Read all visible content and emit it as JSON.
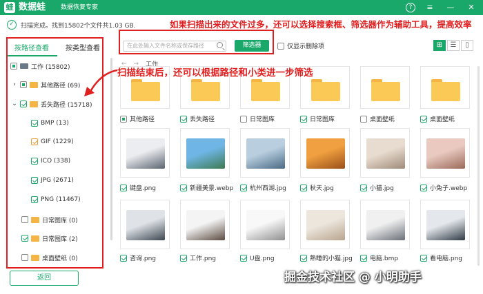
{
  "titlebar": {
    "logo_glyph": "蛙",
    "app_name": "数据蛙",
    "subtitle": "数据恢复专家",
    "help_glyph": "?",
    "menu_glyph": "≡",
    "minimize_glyph": "—",
    "close_glyph": "✕"
  },
  "status": {
    "check_glyph": "✓",
    "text": "扫描完成。找到15802个文件共1.03 GB."
  },
  "annotations": {
    "top_note": "如果扫描出来的文件过多，还可以选择搜索框、筛选器作为辅助工具，提高效率",
    "side_note": "扫描结束后，还可以根据路径和小类进一步筛选",
    "color": "#e02020"
  },
  "sidebar": {
    "tabs": [
      "按路径查看",
      "按类型查看"
    ],
    "tree": [
      {
        "label": "工作 (15802)",
        "state": "partial",
        "chevron": "",
        "icon": "drive"
      },
      {
        "label": "其他路径 (69)",
        "state": "partial",
        "chevron": "›",
        "icon": "folder"
      },
      {
        "label": "丢失路径 (15718)",
        "state": "checked",
        "chevron": "⌄",
        "icon": "folder"
      },
      {
        "label": "BMP (13)",
        "state": "checked",
        "chevron": "",
        "icon": ""
      },
      {
        "label": "GIF (1229)",
        "state": "checked-orange",
        "chevron": "",
        "icon": ""
      },
      {
        "label": "ICO (338)",
        "state": "checked",
        "chevron": "",
        "icon": ""
      },
      {
        "label": "JPG (2671)",
        "state": "checked",
        "chevron": "",
        "icon": ""
      },
      {
        "label": "PNG (11467)",
        "state": "checked",
        "chevron": "",
        "icon": ""
      },
      {
        "label": "日常图库 (0)",
        "state": "unchecked",
        "chevron": "",
        "icon": "folder"
      },
      {
        "label": "日常图库 (2)",
        "state": "checked",
        "chevron": "",
        "icon": "folder"
      },
      {
        "label": "桌面壁纸 (0)",
        "state": "unchecked",
        "chevron": "",
        "icon": "folder"
      }
    ],
    "back_label": "返回"
  },
  "toolbar": {
    "search_placeholder": "在此处输入文件名称或保存路径",
    "filter_label": "筛选器",
    "deleted_only_label": "仅显示删除项",
    "view_glyphs": [
      "⊞",
      "☰",
      "▯"
    ]
  },
  "breadcrumb": [
    "←",
    "→",
    "工作"
  ],
  "grid": [
    {
      "name": "其他路径",
      "kind": "folder",
      "state": "partial",
      "icon": "folder-icon"
    },
    {
      "name": "丢失路径",
      "kind": "folder",
      "state": "checked",
      "icon": "folder-icon"
    },
    {
      "name": "日常图库",
      "kind": "folder",
      "state": "unchecked",
      "icon": "folder-icon"
    },
    {
      "name": "日常图库",
      "kind": "folder",
      "state": "checked",
      "icon": "folder-icon"
    },
    {
      "name": "桌面壁纸",
      "kind": "folder",
      "state": "unchecked",
      "icon": "folder-icon"
    },
    {
      "name": "桌面壁纸",
      "kind": "folder",
      "state": "checked",
      "icon": "folder-icon"
    },
    {
      "name": "键盘.png",
      "kind": "image",
      "state": "checked",
      "icon": "keyboard-thumbnail",
      "colors": [
        "#ecedf0",
        "#5a6470"
      ]
    },
    {
      "name": "新疆美景.webp",
      "kind": "image",
      "state": "checked",
      "icon": "landscape-thumbnail",
      "colors": [
        "#6fb6e6",
        "#3d7a52"
      ]
    },
    {
      "name": "杭州西湖.jpg",
      "kind": "image",
      "state": "checked",
      "icon": "lake-thumbnail",
      "colors": [
        "#b9cfe0",
        "#4a6a84"
      ]
    },
    {
      "name": "秋天.jpg",
      "kind": "image",
      "state": "checked",
      "icon": "autumn-thumbnail",
      "colors": [
        "#f0a040",
        "#9a5018"
      ]
    },
    {
      "name": "小猫.jpg",
      "kind": "image",
      "state": "checked",
      "icon": "kitten-thumbnail",
      "colors": [
        "#e8dcd0",
        "#a08a78"
      ]
    },
    {
      "name": "小兔子.webp",
      "kind": "image",
      "state": "checked",
      "icon": "rabbit-thumbnail",
      "colors": [
        "#e9c9c0",
        "#9a6a5a"
      ]
    },
    {
      "name": "咨询.png",
      "kind": "image",
      "state": "checked",
      "icon": "consult-thumbnail",
      "colors": [
        "#dfe3e8",
        "#3c4650"
      ]
    },
    {
      "name": "工作.png",
      "kind": "image",
      "state": "checked",
      "icon": "work-thumbnail",
      "colors": [
        "#f4f4f4",
        "#5a4a40"
      ]
    },
    {
      "name": "U盘.png",
      "kind": "image",
      "state": "checked",
      "icon": "usb-thumbnail",
      "colors": [
        "#f8f8f8",
        "#909090"
      ]
    },
    {
      "name": "熟睡的小猫.jpg",
      "kind": "image",
      "state": "checked",
      "icon": "sleeping-cat-thumbnail",
      "colors": [
        "#ece6dd",
        "#b8a48e"
      ]
    },
    {
      "name": "电脑.bmp",
      "kind": "image",
      "state": "checked",
      "icon": "laptop-thumbnail",
      "colors": [
        "#f0f0f0",
        "#6a7078"
      ]
    },
    {
      "name": "看电脑.png",
      "kind": "image",
      "state": "checked",
      "icon": "watch-laptop-thumbnail",
      "colors": [
        "#e4e8ec",
        "#2f3a44"
      ]
    }
  ],
  "watermark": "掘金技术社区 @ 小明助手",
  "colors": {
    "accent": "#1aa86a",
    "folder": "#fbc956"
  }
}
